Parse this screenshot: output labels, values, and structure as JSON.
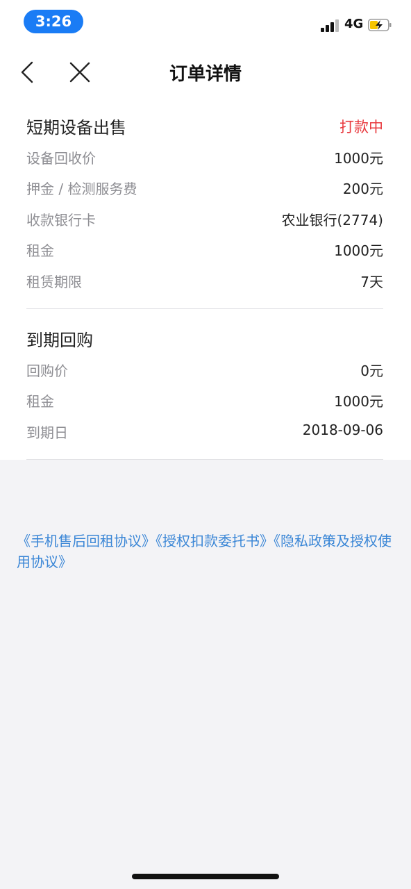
{
  "status_bar": {
    "time": "3:26",
    "network": "4G",
    "accent_color": "#1a7cf5"
  },
  "nav": {
    "title": "订单详情",
    "back_icon": "chevron-left-icon",
    "close_icon": "close-icon"
  },
  "sale_section": {
    "title": "短期设备出售",
    "status": "打款中",
    "status_color": "#e8393e",
    "rows": [
      {
        "label": "设备回收价",
        "value": "1000元"
      },
      {
        "label": "押金 / 检测服务费",
        "value": "200元"
      },
      {
        "label": "收款银行卡",
        "value": "农业银行(2774)"
      },
      {
        "label": "租金",
        "value": "1000元"
      },
      {
        "label": "租赁期限",
        "value": "7天"
      }
    ]
  },
  "buyback_section": {
    "title": "到期回购",
    "rows": [
      {
        "label": "回购价",
        "value": "0元"
      },
      {
        "label": "租金",
        "value": "1000元"
      },
      {
        "label": "到期日",
        "value": "2018-09-06"
      }
    ]
  },
  "agreements": {
    "links": [
      "《手机售后回租协议》",
      "《授权扣款委托书》",
      "《隐私政策及授权使用协议》"
    ],
    "link_color": "#3a86d6"
  }
}
